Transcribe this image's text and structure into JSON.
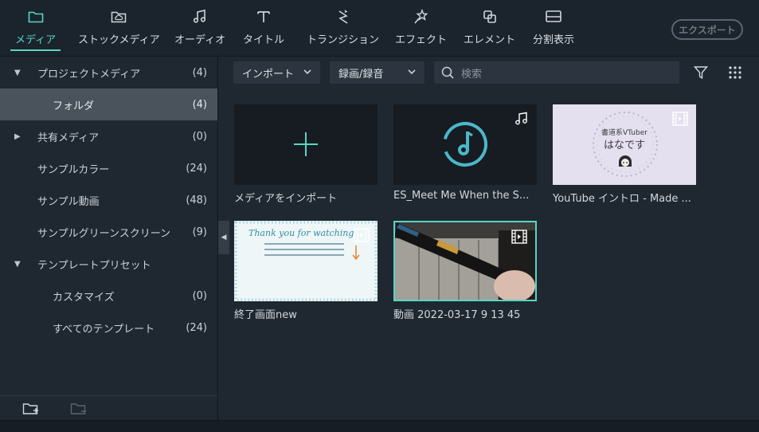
{
  "tabs": [
    {
      "label": "メディア",
      "icon": "folder-icon",
      "active": true
    },
    {
      "label": "ストックメディア",
      "icon": "cloud-folder-icon",
      "active": false
    },
    {
      "label": "オーディオ",
      "icon": "music-note-icon",
      "active": false
    },
    {
      "label": "タイトル",
      "icon": "text-icon",
      "active": false
    },
    {
      "label": "トランジション",
      "icon": "transition-icon",
      "active": false
    },
    {
      "label": "エフェクト",
      "icon": "effects-star-icon",
      "active": false
    },
    {
      "label": "エレメント",
      "icon": "elements-icon",
      "active": false
    },
    {
      "label": "分割表示",
      "icon": "split-screen-icon",
      "active": false
    }
  ],
  "export_label": "エクスポート",
  "sidebar": {
    "items": [
      {
        "label": "プロジェクトメディア",
        "count": "(4)",
        "expanded": true,
        "indent": 0
      },
      {
        "label": "フォルダ",
        "count": "(4)",
        "selected": true,
        "indent": 1
      },
      {
        "label": "共有メディア",
        "count": "(0)",
        "expanded": false,
        "indent": 0
      },
      {
        "label": "サンプルカラー",
        "count": "(24)",
        "indent": 0
      },
      {
        "label": "サンプル動画",
        "count": "(48)",
        "indent": 0
      },
      {
        "label": "サンプルグリーンスクリーン",
        "count": "(9)",
        "indent": 0
      },
      {
        "label": "テンプレートプリセット",
        "count": "",
        "expanded": true,
        "indent": 0
      },
      {
        "label": "カスタマイズ",
        "count": "(0)",
        "indent": 1
      },
      {
        "label": "すべてのテンプレート",
        "count": "(24)",
        "indent": 1
      }
    ]
  },
  "toolbar": {
    "import_label": "インポート",
    "record_label": "録画/録音",
    "search_placeholder": "検索"
  },
  "media": [
    {
      "caption": "メディアをインポート",
      "kind": "import"
    },
    {
      "caption": "ES_Meet Me When the S...",
      "kind": "audio"
    },
    {
      "caption": "YouTube イントロ - Made ...",
      "kind": "video",
      "thumb_text": [
        "書道系VTuber",
        "はなです"
      ]
    },
    {
      "caption": "終了画面new",
      "kind": "video",
      "thumb_text": [
        "Thank you for watching"
      ]
    },
    {
      "caption": "動画 2022-03-17 9 13 45",
      "kind": "video",
      "selected": true
    }
  ],
  "colors": {
    "accent": "#57d6c3",
    "background": "#1f2730",
    "selected_row": "#4a535c"
  }
}
